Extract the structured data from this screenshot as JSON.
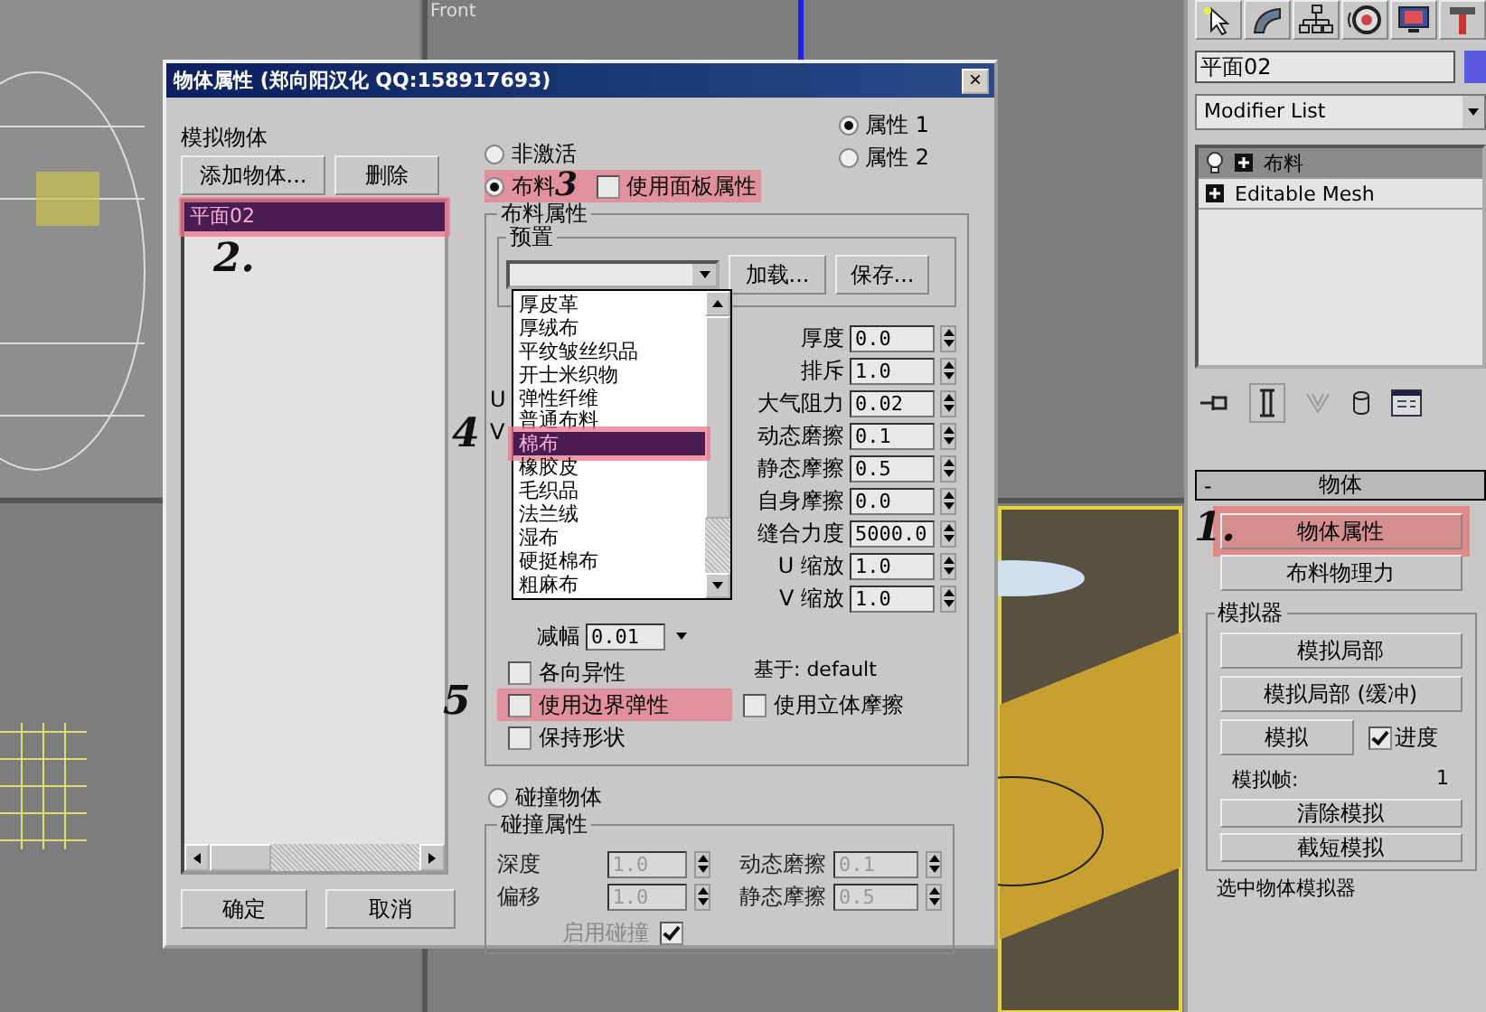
{
  "viewport": {
    "label": "Front"
  },
  "dialog": {
    "title": "物体属性 (郑向阳汉化 QQ:158917693)",
    "close": "×",
    "objects_label": "模拟物体",
    "add_button": "添加物体...",
    "delete_button": "删除",
    "object_list": [
      {
        "label": "平面02",
        "selected": true,
        "annotation": "2."
      }
    ],
    "ok_button": "确定",
    "cancel_button": "取消",
    "property_sets": [
      {
        "label": "属性 1",
        "selected": true
      },
      {
        "label": "属性 2",
        "selected": false
      }
    ],
    "modes": [
      {
        "label": "非激活",
        "selected": false
      },
      {
        "label": "布料",
        "selected": true,
        "annotation": "3"
      },
      {
        "label": "碰撞物体",
        "selected": false
      }
    ],
    "use_panel_properties": {
      "label": "使用面板属性",
      "checked": false
    },
    "cloth_group": {
      "title": "布料属性",
      "preset_title": "预置",
      "load_button": "加载...",
      "save_button": "保存...",
      "preset_options": [
        {
          "label": "厚皮革",
          "selected": false
        },
        {
          "label": "厚绒布",
          "selected": false
        },
        {
          "label": "平纹皱丝织品",
          "selected": false
        },
        {
          "label": "开士米织物",
          "selected": false
        },
        {
          "label": "弹性纤维",
          "selected": false
        },
        {
          "label": "普通布料",
          "selected": false
        },
        {
          "label": "棉布",
          "selected": true,
          "annotation": "4"
        },
        {
          "label": "橡胶皮",
          "selected": false
        },
        {
          "label": "毛织品",
          "selected": false
        },
        {
          "label": "法兰绒",
          "selected": false
        },
        {
          "label": "湿布",
          "selected": false
        },
        {
          "label": "硬挺棉布",
          "selected": false
        },
        {
          "label": "粗麻布",
          "selected": false
        }
      ],
      "hidden_labels": [
        "U",
        "V"
      ],
      "damping": {
        "label": "减幅",
        "value": "0.01"
      },
      "params": [
        {
          "label": "厚度",
          "value": "0.0"
        },
        {
          "label": "排斥",
          "value": "1.0"
        },
        {
          "label": "大气阻力",
          "value": "0.02"
        },
        {
          "label": "动态磨擦",
          "value": "0.1"
        },
        {
          "label": "静态摩擦",
          "value": "0.5"
        },
        {
          "label": "自身摩擦",
          "value": "0.0"
        },
        {
          "label": "缝合力度",
          "value": "5000.0"
        },
        {
          "label": "U 缩放",
          "value": "1.0"
        },
        {
          "label": "V 缩放",
          "value": "1.0"
        }
      ],
      "based_on": "基于: default",
      "checkboxes": [
        {
          "label": "各向异性",
          "checked": false
        },
        {
          "label": "使用边界弹性",
          "checked": false,
          "annotation": "5"
        },
        {
          "label": "保持形状",
          "checked": false
        }
      ],
      "solid_friction": {
        "label": "使用立体摩擦",
        "checked": false
      }
    },
    "collision_group": {
      "title": "碰撞属性",
      "disabled": true,
      "params": [
        {
          "label": "深度",
          "value": "1.0"
        },
        {
          "label": "偏移",
          "value": "1.0"
        },
        {
          "label": "动态磨擦",
          "value": "0.1"
        },
        {
          "label": "静态摩擦",
          "value": "0.5"
        }
      ],
      "enable": {
        "label": "启用碰撞",
        "checked": true
      }
    }
  },
  "command_panel": {
    "object_name": "平面02",
    "modifier_dropdown": "Modifier List",
    "stack": [
      {
        "label": "布料",
        "selected": true,
        "kind": "modifier"
      },
      {
        "label": "Editable Mesh",
        "selected": false,
        "kind": "base"
      }
    ],
    "rollout": {
      "collapse": "-",
      "title": "物体",
      "buttons": [
        {
          "label": "物体属性",
          "annotation": "1."
        },
        {
          "label": "布料物理力"
        }
      ],
      "simulator": {
        "title": "模拟器",
        "buttons": [
          "模拟局部",
          "模拟局部 (缓冲)"
        ],
        "simulate": "模拟",
        "progress": {
          "label": "进度",
          "checked": true
        },
        "frame_label": "模拟帧:",
        "frame_value": "1",
        "bottom_buttons": [
          "清除模拟",
          "截短模拟"
        ]
      },
      "next_title": "选中物体模拟器"
    }
  }
}
